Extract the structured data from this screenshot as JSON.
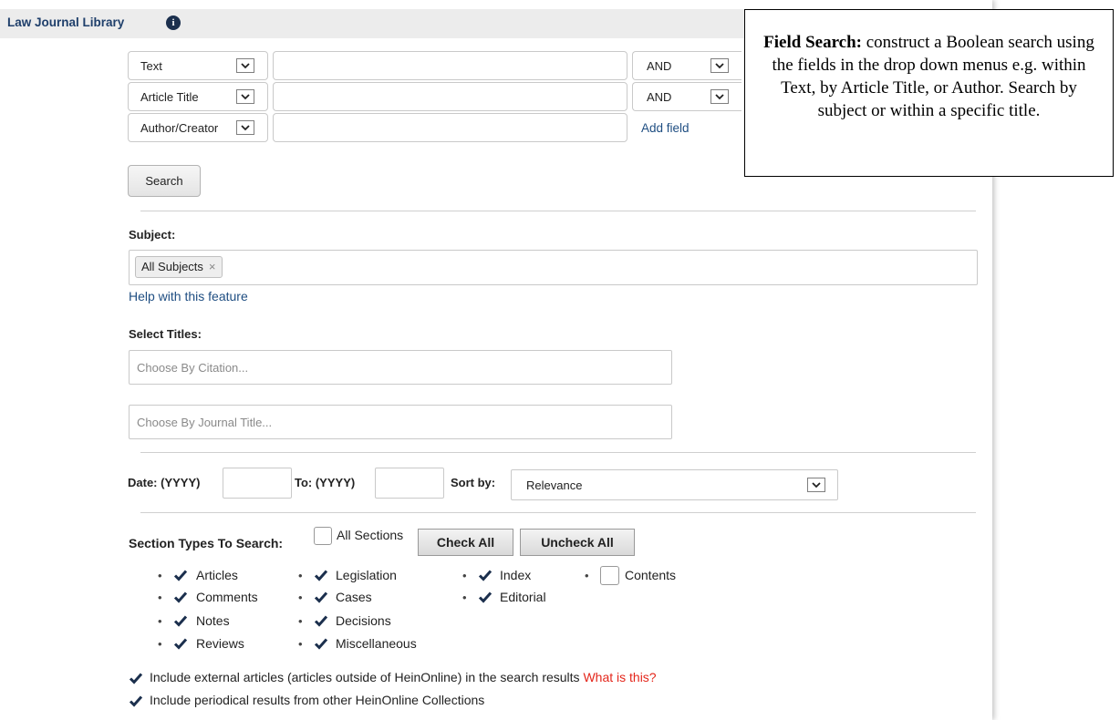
{
  "header": {
    "title": "Law Journal Library"
  },
  "rows": [
    {
      "field": "Text",
      "value": "",
      "operator": "AND"
    },
    {
      "field": "Article Title",
      "value": "",
      "operator": "AND"
    },
    {
      "field": "Author/Creator",
      "value": ""
    }
  ],
  "add_field_label": "Add field",
  "search_button": "Search",
  "subject": {
    "label": "Subject:",
    "tag": "All Subjects",
    "tag_remove": "×",
    "help_link": "Help with this feature"
  },
  "titles": {
    "label": "Select Titles:",
    "citation_placeholder": "Choose By Citation...",
    "journal_placeholder": "Choose By Journal Title..."
  },
  "date": {
    "from_label": "Date: (YYYY)",
    "from_value": "",
    "to_label": "To: (YYYY)",
    "to_value": "",
    "sort_label": "Sort by:",
    "sort_value": "Relevance"
  },
  "sections": {
    "label": "Section Types To Search:",
    "all_label": "All Sections",
    "all_checked": false,
    "check_all": "Check All",
    "uncheck_all": "Uncheck All",
    "columns": [
      [
        {
          "label": "Articles",
          "checked": true
        },
        {
          "label": "Comments",
          "checked": true
        },
        {
          "label": "Notes",
          "checked": true
        },
        {
          "label": "Reviews",
          "checked": true
        }
      ],
      [
        {
          "label": "Legislation",
          "checked": true
        },
        {
          "label": "Cases",
          "checked": true
        },
        {
          "label": "Decisions",
          "checked": true
        },
        {
          "label": "Miscellaneous",
          "checked": true
        }
      ],
      [
        {
          "label": "Index",
          "checked": true
        },
        {
          "label": "Editorial",
          "checked": true
        }
      ],
      [
        {
          "label": "Contents",
          "checked": false
        }
      ]
    ]
  },
  "options": {
    "external": {
      "label": "Include external articles (articles outside of HeinOnline) in the search results",
      "link": "What is this?",
      "checked": true
    },
    "periodical": {
      "label": "Include periodical results from other HeinOnline Collections",
      "checked": true
    }
  },
  "callout": {
    "heading": "Field Search:",
    "text": " construct a Boolean search using the fields in the drop down menus e.g. within Text, by Article Title, or Author. Search by subject or within a specific title."
  },
  "colors": {
    "link": "#1f4e82",
    "warning_link": "#e4261b",
    "header_bg": "#ececec"
  }
}
